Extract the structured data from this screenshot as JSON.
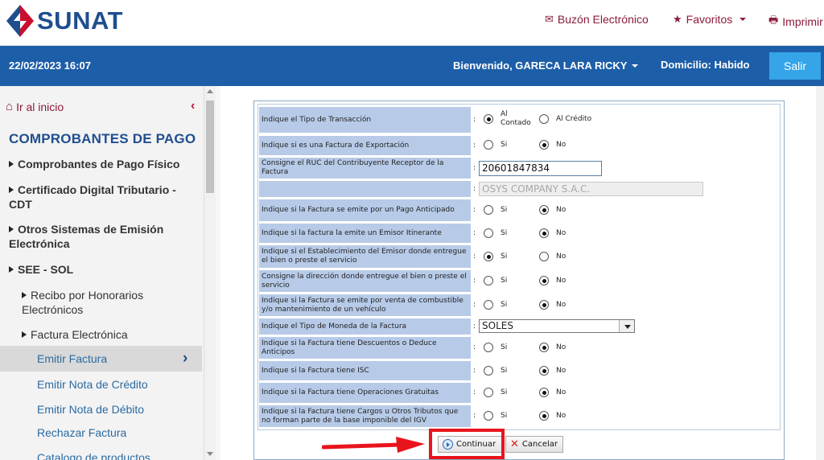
{
  "header": {
    "logo_text": "SUNAT",
    "nav": {
      "buzon": "Buzón Electrónico",
      "favoritos": "Favoritos",
      "imprimir": "Imprimir"
    }
  },
  "bluebar": {
    "datetime": "22/02/2023 16:07",
    "welcome": "Bienvenido, GARECA LARA RICKY",
    "domicilio": "Domicilio: Habido",
    "salir": "Salir"
  },
  "sidebar": {
    "home": "Ir al inicio",
    "heading": "COMPROBANTES DE PAGO",
    "items": [
      "Comprobantes de Pago Físico",
      "Certificado Digital Tributario - CDT",
      "Otros Sistemas de Emisión Electrónica",
      "SEE - SOL",
      "Recibo por Honorarios Electrónicos",
      "Factura Electrónica",
      "Emitir Factura",
      "Emitir Nota de Crédito",
      "Emitir Nota de Débito",
      "Rechazar Factura",
      "Catalogo de productos"
    ]
  },
  "form": {
    "rows": [
      {
        "label": "Indique el Tipo de Transacción",
        "opt1": "Al Contado",
        "opt2": "Al Crédito",
        "selected": "opt1"
      },
      {
        "label": "Indique si es una Factura de Exportación",
        "opt1": "Si",
        "opt2": "No",
        "selected": "opt2"
      },
      {
        "label": "Consigne el RUC del Contribuyente Receptor de la Factura",
        "value": "20601847834"
      },
      {
        "label": "",
        "value": "OSYS COMPANY S.A.C."
      },
      {
        "label": "Indique si la Factura se emite por un Pago Anticipado",
        "opt1": "Si",
        "opt2": "No",
        "selected": "opt2"
      },
      {
        "label": "Indique si la factura la emite un Emisor Itinerante",
        "opt1": "Si",
        "opt2": "No",
        "selected": "opt2"
      },
      {
        "label": "Indique si el Establecimiento del Emisor donde entregue el bien o preste el servicio",
        "opt1": "Si",
        "opt2": "No",
        "selected": "opt1"
      },
      {
        "label": "Consigne la dirección donde entregue el bien o preste el servicio",
        "opt1": "Si",
        "opt2": "No",
        "selected": "opt2"
      },
      {
        "label": "Indique si la Factura se emite por venta de combustible y/o mantenimiento de un vehículo",
        "opt1": "Si",
        "opt2": "No",
        "selected": "opt2"
      },
      {
        "label": "Indique el Tipo de Moneda de la Factura",
        "value": "SOLES"
      },
      {
        "label": "Indique si la Factura tiene Descuentos o Deduce Anticipos",
        "opt1": "Si",
        "opt2": "No",
        "selected": "opt2"
      },
      {
        "label": "Indique si la Factura tiene ISC",
        "opt1": "Si",
        "opt2": "No",
        "selected": "opt2"
      },
      {
        "label": "Indique si la Factura tiene Operaciones Gratuitas",
        "opt1": "Si",
        "opt2": "No",
        "selected": "opt2"
      },
      {
        "label": "Indique si la Factura tiene Cargos u Otros Tributos que no forman parte de la base imponible del IGV",
        "opt1": "Si",
        "opt2": "No",
        "selected": "opt2"
      }
    ],
    "colon": ":",
    "continuar": "Continuar",
    "cancelar": "Cancelar"
  },
  "colors": {
    "brand_blue": "#1d5ea8",
    "label_bg": "#b7cbe8",
    "highlight_red": "#e8141c",
    "nav_text": "#8b1c3a"
  }
}
